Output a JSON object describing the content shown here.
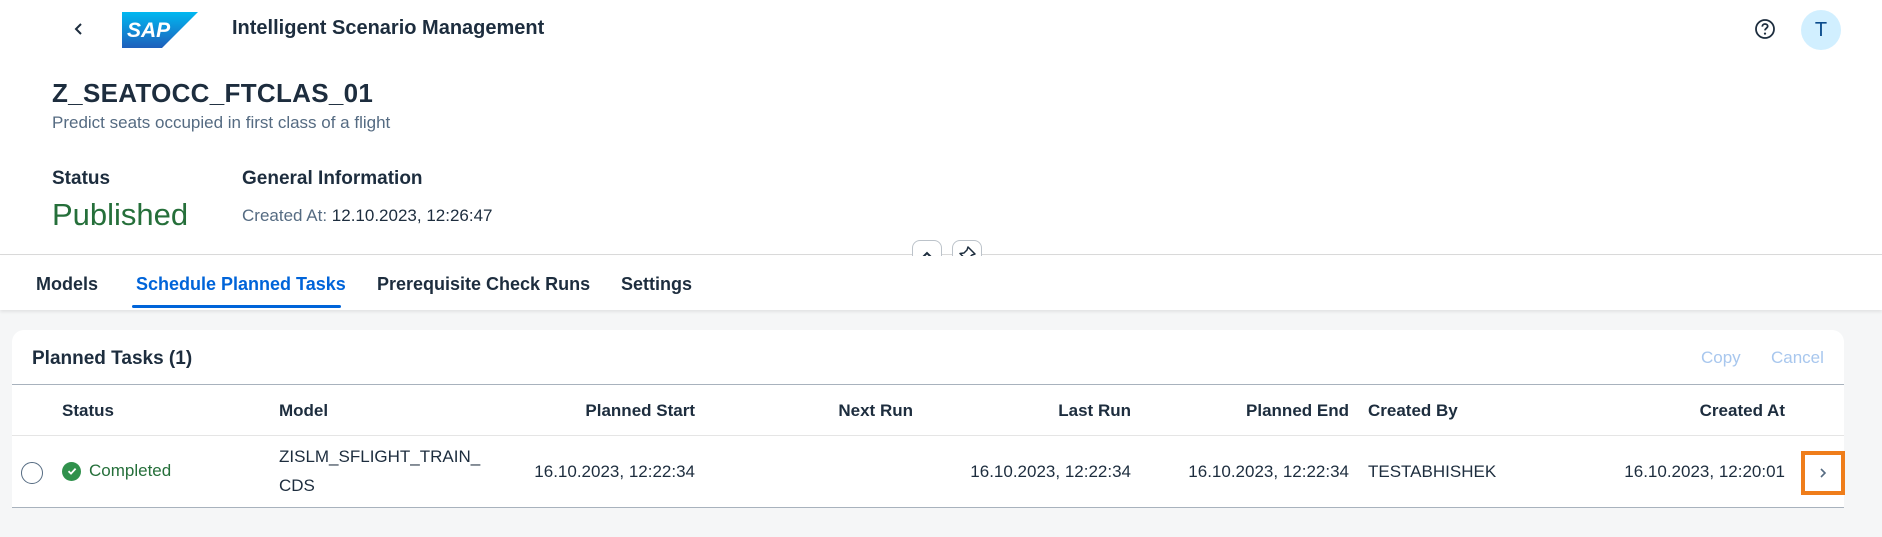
{
  "shell": {
    "app_title": "Intelligent Scenario Management",
    "logo_text": "SAP",
    "avatar_initial": "T"
  },
  "object": {
    "title": "Z_SEATOCC_FTCLAS_01",
    "subtitle": "Predict seats occupied in first class of a flight",
    "status_label": "Status",
    "status_value": "Published",
    "general_info_label": "General Information",
    "created_at_label": "Created At:",
    "created_at_value": "12.10.2023, 12:26:47"
  },
  "tabs": [
    {
      "label": "Models",
      "active": false
    },
    {
      "label": "Schedule Planned Tasks",
      "active": true
    },
    {
      "label": "Prerequisite Check Runs",
      "active": false
    },
    {
      "label": "Settings",
      "active": false
    }
  ],
  "table": {
    "title": "Planned Tasks (1)",
    "toolbar": {
      "copy": "Copy",
      "cancel": "Cancel"
    },
    "columns": [
      "Status",
      "Model",
      "Planned Start",
      "Next Run",
      "Last Run",
      "Planned End",
      "Created By",
      "Created At"
    ],
    "rows": [
      {
        "status": "Completed",
        "model_line1": "ZISLM_SFLIGHT_TRAIN_",
        "model_line2": "CDS",
        "planned_start": "16.10.2023, 12:22:34",
        "next_run": "",
        "last_run": "16.10.2023, 12:22:34",
        "planned_end": "16.10.2023, 12:22:34",
        "created_by": "TESTABHISHEK",
        "created_at": "16.10.2023, 12:20:01"
      }
    ]
  },
  "icons": {
    "back": "chevron-left-icon",
    "help": "question-mark-icon",
    "collapse": "chevron-up-icon",
    "pin": "pin-off-icon",
    "row_status": "check-circle-icon",
    "row_nav": "chevron-right-icon"
  },
  "colors": {
    "accent": "#0064d9",
    "success": "#256f3a",
    "highlight_border": "#ef7d1a",
    "disabled_action": "#a8c7ee"
  }
}
